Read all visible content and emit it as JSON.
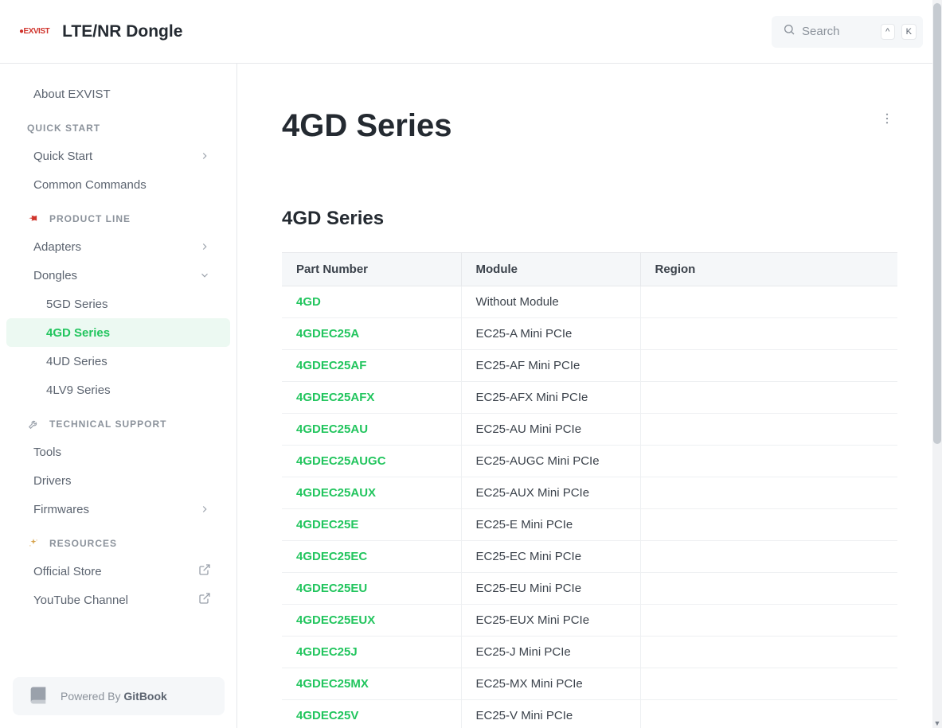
{
  "header": {
    "logo_text": "EXVIST",
    "site_title": "LTE/NR Dongle",
    "search_placeholder": "Search",
    "kbd1": "^",
    "kbd2": "K"
  },
  "sidebar": {
    "top_item": "About EXVIST",
    "sections": {
      "quick_start": {
        "label": "QUICK START",
        "items": [
          "Quick Start",
          "Common Commands"
        ]
      },
      "product_line": {
        "label": "PRODUCT LINE",
        "items": [
          "Adapters",
          "Dongles"
        ],
        "dongles_children": [
          "5GD Series",
          "4GD Series",
          "4UD Series",
          "4LV9 Series"
        ]
      },
      "technical_support": {
        "label": "TECHNICAL SUPPORT",
        "items": [
          "Tools",
          "Drivers",
          "Firmwares"
        ]
      },
      "resources": {
        "label": "RESOURCES",
        "items": [
          "Official Store",
          "YouTube Channel"
        ]
      }
    },
    "powered_prefix": "Powered By ",
    "powered_brand": "GitBook"
  },
  "page": {
    "title": "4GD Series",
    "section_heading": "4GD Series",
    "table": {
      "headers": [
        "Part Number",
        "Module",
        "Region"
      ],
      "rows": [
        {
          "part": "4GD",
          "module": "Without Module",
          "region": ""
        },
        {
          "part": "4GDEC25A",
          "module": "EC25-A Mini PCIe",
          "region": ""
        },
        {
          "part": "4GDEC25AF",
          "module": "EC25-AF Mini PCIe",
          "region": ""
        },
        {
          "part": "4GDEC25AFX",
          "module": "EC25-AFX Mini PCIe",
          "region": ""
        },
        {
          "part": "4GDEC25AU",
          "module": "EC25-AU Mini PCIe",
          "region": ""
        },
        {
          "part": "4GDEC25AUGC",
          "module": "EC25-AUGC Mini PCIe",
          "region": ""
        },
        {
          "part": "4GDEC25AUX",
          "module": "EC25-AUX Mini PCIe",
          "region": ""
        },
        {
          "part": "4GDEC25E",
          "module": "EC25-E Mini PCIe",
          "region": ""
        },
        {
          "part": "4GDEC25EC",
          "module": "EC25-EC Mini PCIe",
          "region": ""
        },
        {
          "part": "4GDEC25EU",
          "module": "EC25-EU Mini PCIe",
          "region": ""
        },
        {
          "part": "4GDEC25EUX",
          "module": "EC25-EUX Mini PCIe",
          "region": ""
        },
        {
          "part": "4GDEC25J",
          "module": "EC25-J Mini PCIe",
          "region": ""
        },
        {
          "part": "4GDEC25MX",
          "module": "EC25-MX Mini PCIe",
          "region": ""
        },
        {
          "part": "4GDEC25V",
          "module": "EC25-V Mini PCIe",
          "region": ""
        }
      ]
    }
  }
}
